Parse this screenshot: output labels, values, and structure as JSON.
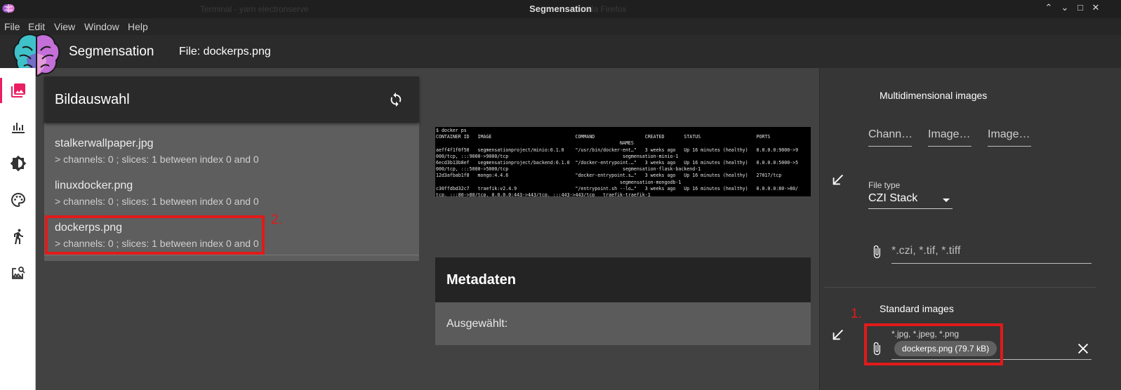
{
  "window": {
    "title": "Segmensation",
    "bg_tabs": [
      "Terminal - yarn electronserve",
      "Mozilla Firefox"
    ]
  },
  "menu": [
    "File",
    "Edit",
    "View",
    "Window",
    "Help"
  ],
  "header": {
    "app_title": "Segmensation",
    "file_label": "File: dockerps.png"
  },
  "nav": {
    "items": [
      "images-icon",
      "chart-icon",
      "brightness-icon",
      "palette-icon",
      "run-icon",
      "image-search-icon"
    ]
  },
  "image_list": {
    "title": "Bildauswahl",
    "items": [
      {
        "name": "stalkerwallpaper.jpg",
        "detail": "> channels: 0 ; slices: 1 between index 0 and 0"
      },
      {
        "name": "linuxdocker.png",
        "detail": "> channels: 0 ; slices: 1 between index 0 and 0"
      },
      {
        "name": "dockerps.png",
        "detail": "> channels: 0 ; slices: 1 between index 0 and 0"
      }
    ]
  },
  "annotations": {
    "step1": "1.",
    "step2": "2."
  },
  "preview": {
    "lines": [
      "$ docker ps",
      "CONTAINER ID   IMAGE                              COMMAND                  CREATED       STATUS                    PORTS",
      "                                                                  NAMES",
      "aeff4f1f0f50   segmensationproject/minio:0.1.0    \"/usr/bin/docker-ent…\"   3 weeks ago   Up 16 minutes (healthy)   0.0.0.0:9000->9",
      "000/tcp, :::9000->9000/tcp                                         segmensation-minio-1",
      "6ecd3b13b8ef   segmensationproject/backend:0.1.0  \"/docker-entrypoint.…\"   3 weeks ago   Up 16 minutes (healthy)   0.0.0.0:5000->5",
      "000/tcp, :::5000->5000/tcp                                         segmensation-flask-backend-1",
      "12d3afbab1f8   mongo:4.4.6                        \"docker-entrypoint.s…\"   3 weeks ago   Up 16 minutes (healthy)   27017/tcp",
      "                                                                  segmensation-mongodb-1",
      "c30ffdbd32c7   traefik:v2.4.9                     \"/entrypoint.sh --lo…\"   3 weeks ago   Up 16 minutes (healthy)   0.0.0.0:80->80/",
      "tcp, :::80->80/tcp, 0.0.0.0:443->443/tcp, :::443->443/tcp   traefik-traefik-1"
    ]
  },
  "metadata": {
    "title": "Metadaten",
    "selected_label": "Ausgewählt:"
  },
  "upload": {
    "multi_title": "Multidimensional images",
    "dim_fields": [
      "Chann…",
      "Image…",
      "Image…"
    ],
    "file_type_label": "File type",
    "file_type_value": "CZI Stack",
    "multi_placeholder": "*.czi, *.tif, *.tiff",
    "std_title": "Standard images",
    "std_accept": "*.jpg, *.jpeg, *.png",
    "std_chip": "dockerps.png (79.7 kB)"
  }
}
